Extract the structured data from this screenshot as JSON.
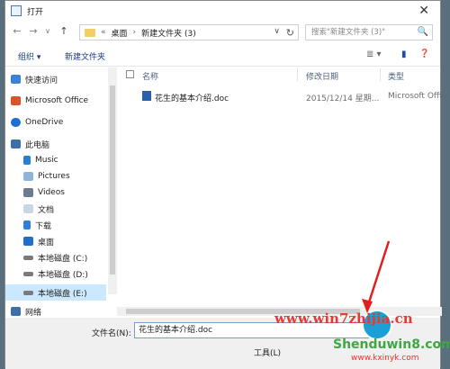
{
  "window": {
    "title": "打开",
    "close_label": "✕"
  },
  "nav": {
    "back": "←",
    "forward": "→",
    "dropdown": "∨",
    "up": "↑",
    "breadcrumb_root": "«",
    "breadcrumb": [
      "桌面",
      "新建文件夹 (3)"
    ],
    "breadcrumb_sep": "›",
    "refresh": "↻",
    "addr_dropdown": "∨",
    "search_placeholder": "搜索\"新建文件夹 (3)\"",
    "search_icon": "🔍"
  },
  "toolbar": {
    "organize": "组织 ▾",
    "new_folder": "新建文件夹",
    "view_icon": "≣ ▾",
    "pane_icon": "▮",
    "help_icon": "❓"
  },
  "sidebar": [
    {
      "label": "快速访问",
      "icon": "star-icon"
    },
    {
      "label": "Microsoft Office",
      "icon": "office-icon"
    },
    {
      "label": "OneDrive",
      "icon": "cloud-icon"
    },
    {
      "label": "此电脑",
      "icon": "pc-icon"
    },
    {
      "label": "Music",
      "icon": "music-icon"
    },
    {
      "label": "Pictures",
      "icon": "pictures-icon"
    },
    {
      "label": "Videos",
      "icon": "videos-icon"
    },
    {
      "label": "文档",
      "icon": "documents-icon"
    },
    {
      "label": "下载",
      "icon": "download-icon"
    },
    {
      "label": "桌面",
      "icon": "desktop-icon"
    },
    {
      "label": "本地磁盘 (C:)",
      "icon": "drive-icon"
    },
    {
      "label": "本地磁盘 (D:)",
      "icon": "drive-icon"
    },
    {
      "label": "本地磁盘 (E:)",
      "icon": "drive-icon",
      "selected": true
    },
    {
      "label": "网络",
      "icon": "network-icon"
    }
  ],
  "columns": {
    "name": "名称",
    "modified": "修改日期",
    "type": "类型"
  },
  "files": [
    {
      "name": "花生的基本介绍.doc",
      "modified": "2015/12/14 星期...",
      "type": "Microsoft Office"
    }
  ],
  "footer": {
    "filename_label": "文件名(N):",
    "filename_value": "花生的基本介绍.doc",
    "tools_label": "工具(L)"
  },
  "watermark": {
    "line1": "www.win7zhijia.cn",
    "line2": "Shenduwin8.com",
    "line3": "www.kxinyk.com"
  }
}
